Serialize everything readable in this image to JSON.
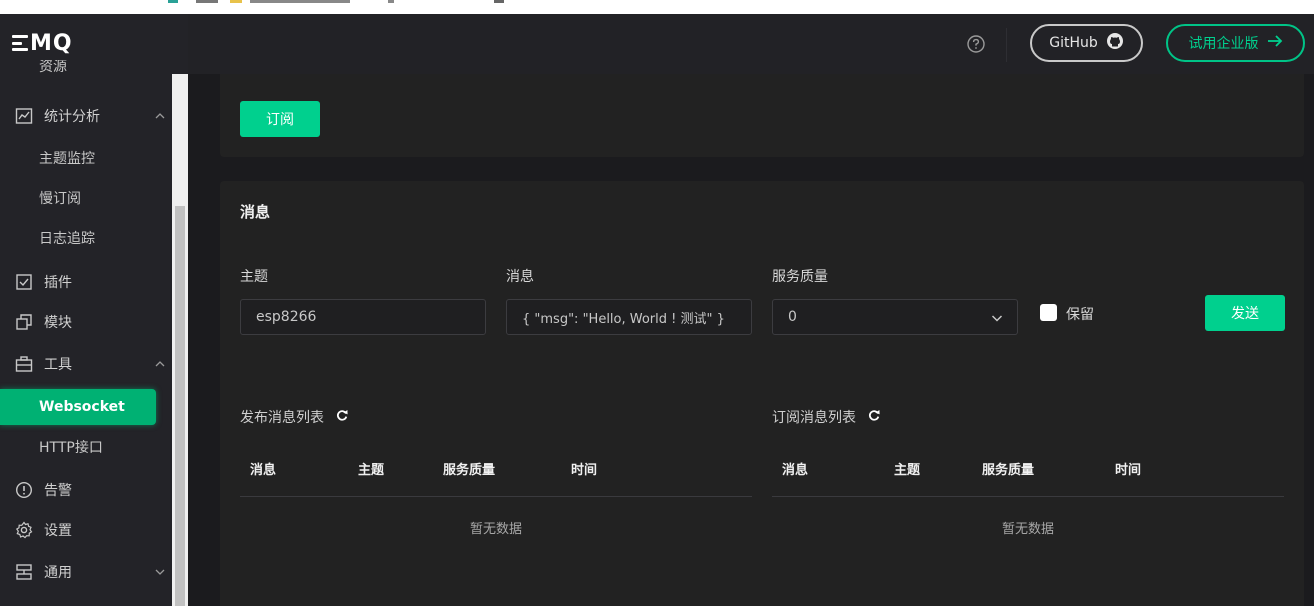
{
  "colors": {
    "accent": "#00d08e",
    "sidebar_bg": "#232328",
    "page_bg": "#1b1b1e",
    "card_bg": "#222222"
  },
  "logo": {
    "text": "MQ",
    "icon": "emq-logo-bars"
  },
  "sidebar": {
    "partial_item": "资源",
    "groups": [
      {
        "label": "统计分析",
        "icon": "chart-line-icon",
        "expanded": true,
        "children": [
          "主题监控",
          "慢订阅",
          "日志追踪"
        ]
      },
      {
        "label": "插件",
        "icon": "checkbox-icon"
      },
      {
        "label": "模块",
        "icon": "modules-icon"
      },
      {
        "label": "工具",
        "icon": "toolbox-icon",
        "expanded": true,
        "children": [
          "Websocket",
          "HTTP接口"
        ],
        "active_child": "Websocket"
      },
      {
        "label": "告警",
        "icon": "alert-circle-icon"
      },
      {
        "label": "设置",
        "icon": "gear-icon"
      },
      {
        "label": "通用",
        "icon": "general-icon",
        "expanded": false
      }
    ]
  },
  "header": {
    "help_icon": "question-circle-icon",
    "github_label": "GitHub",
    "enterprise_label": "试用企业版"
  },
  "subscribe": {
    "button_label": "订阅"
  },
  "messages": {
    "title": "消息",
    "topic_label": "主题",
    "topic_value": "esp8266",
    "message_label": "消息",
    "message_value": "{ \"msg\": \"Hello, World ! 测试\" }",
    "qos_label": "服务质量",
    "qos_value": "0",
    "retain_label": "保留",
    "send_label": "发送",
    "published": {
      "title": "发布消息列表",
      "columns": [
        "消息",
        "主题",
        "服务质量",
        "时间"
      ],
      "empty_text": "暂无数据"
    },
    "subscribed": {
      "title": "订阅消息列表",
      "columns": [
        "消息",
        "主题",
        "服务质量",
        "时间"
      ],
      "empty_text": "暂无数据"
    }
  }
}
